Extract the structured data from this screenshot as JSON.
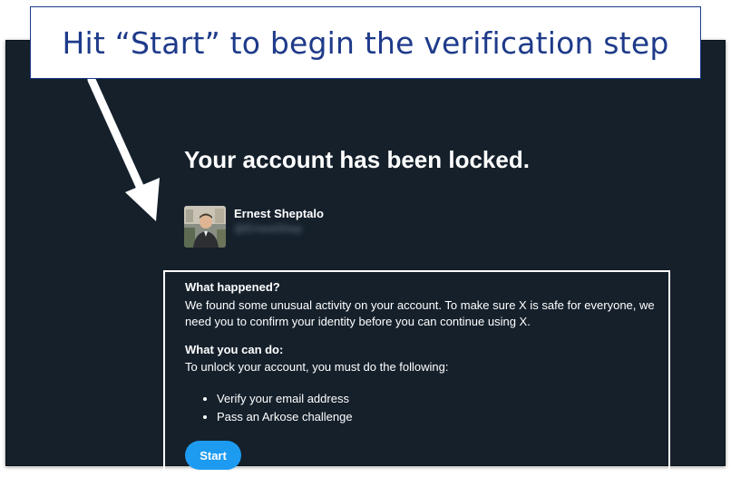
{
  "callout": {
    "text": "Hit “Start” to begin the verification step"
  },
  "page": {
    "title": "Your account has been locked."
  },
  "user": {
    "name": "Ernest Sheptalo",
    "handle": "@ErnestShep"
  },
  "info": {
    "what_happened_heading": "What happened?",
    "what_happened_text": "We found some unusual activity on your account. To make sure X is safe for everyone, we need you to confirm your identity before you can continue using X.",
    "what_you_can_do_heading": "What you can do:",
    "what_you_can_do_text": "To unlock your account, you must do the following:",
    "steps": [
      "Verify your email address",
      "Pass an Arkose challenge"
    ],
    "start_label": "Start"
  },
  "colors": {
    "background": "#15202b",
    "accent": "#1d9bf0",
    "callout_text": "#1e3a8a"
  }
}
